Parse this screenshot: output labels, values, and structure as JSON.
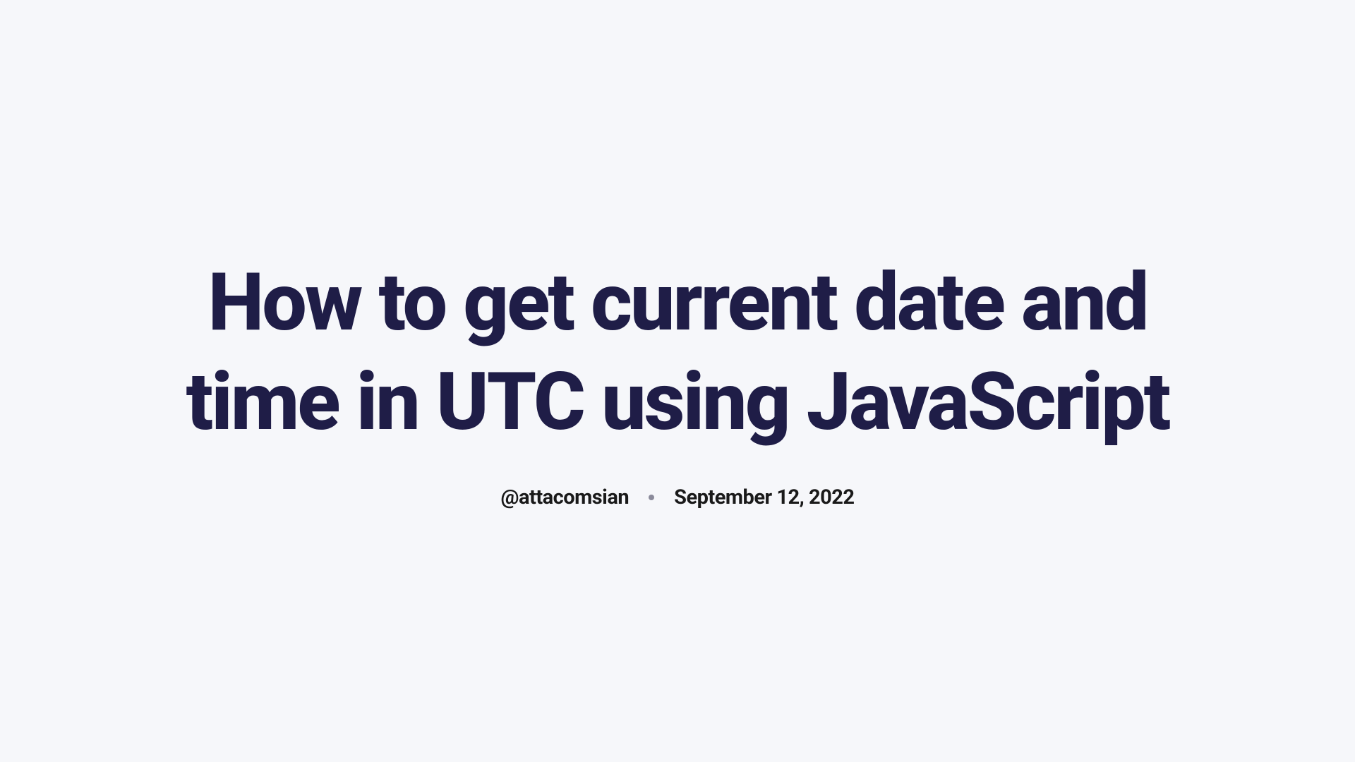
{
  "article": {
    "title": "How to get current date and time in UTC using JavaScript",
    "author": "@attacomsian",
    "date": "September 12, 2022"
  }
}
